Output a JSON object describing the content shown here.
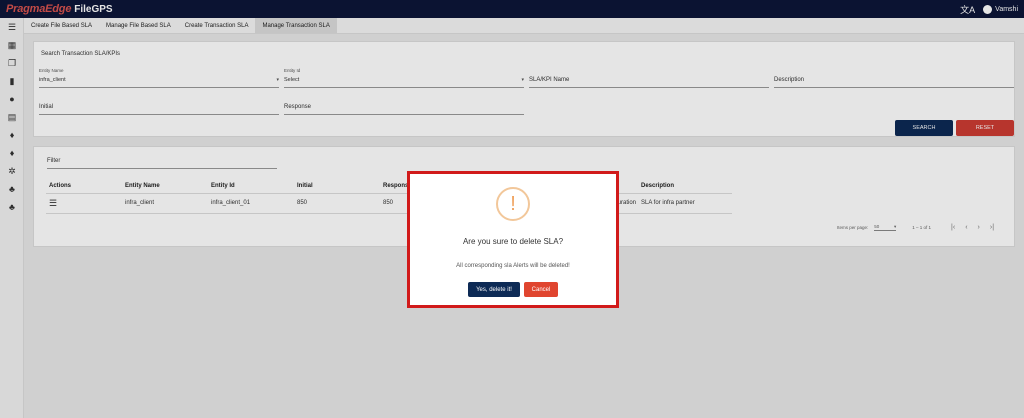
{
  "header": {
    "brand": "PragmaEdge",
    "product": "FileGPS",
    "translate_glyph": "文A",
    "user": "Vamshi"
  },
  "tabs": [
    {
      "label": "Create File Based SLA"
    },
    {
      "label": "Manage File Based SLA"
    },
    {
      "label": "Create Transaction SLA"
    },
    {
      "label": "Manage Transaction SLA",
      "active": true
    }
  ],
  "search": {
    "title": "Search Transaction SLA/KPIs",
    "entity_name_label": "Entity Name",
    "entity_name_value": "infra_client",
    "entity_id_label": "Entity Id",
    "entity_id_value": "Select",
    "sla_kpi_name": "SLA/KPI Name",
    "description": "Description",
    "initial": "Initial",
    "response": "Response",
    "search_button": "SEARCH",
    "reset_button": "RESET"
  },
  "results": {
    "filter_label": "Filter",
    "columns": [
      "Actions",
      "Entity Name",
      "Entity Id",
      "Initial",
      "Respons",
      "",
      "",
      "Description"
    ],
    "rows": [
      {
        "entity_name": "infra_client",
        "entity_id": "infra_client_01",
        "initial": "850",
        "response": "850",
        "hidden": "uration",
        "description": "SLA for infra partner"
      }
    ],
    "items_per_page_label": "Items per page:",
    "items_per_page_value": "50",
    "range_label": "1 – 1 of 1"
  },
  "dialog": {
    "icon_glyph": "!",
    "title": "Are you sure to delete SLA?",
    "message": "All corresponding sla Alerts will be deleted!",
    "confirm_label": "Yes, delete it!",
    "cancel_label": "Cancel"
  },
  "colors": {
    "topbar": "#0d1638",
    "brand": "#d9534f",
    "primary_button": "#0d2a55",
    "danger_button": "#cc3b33",
    "highlight": "#d11a1a",
    "warning": "#f0a35f"
  }
}
